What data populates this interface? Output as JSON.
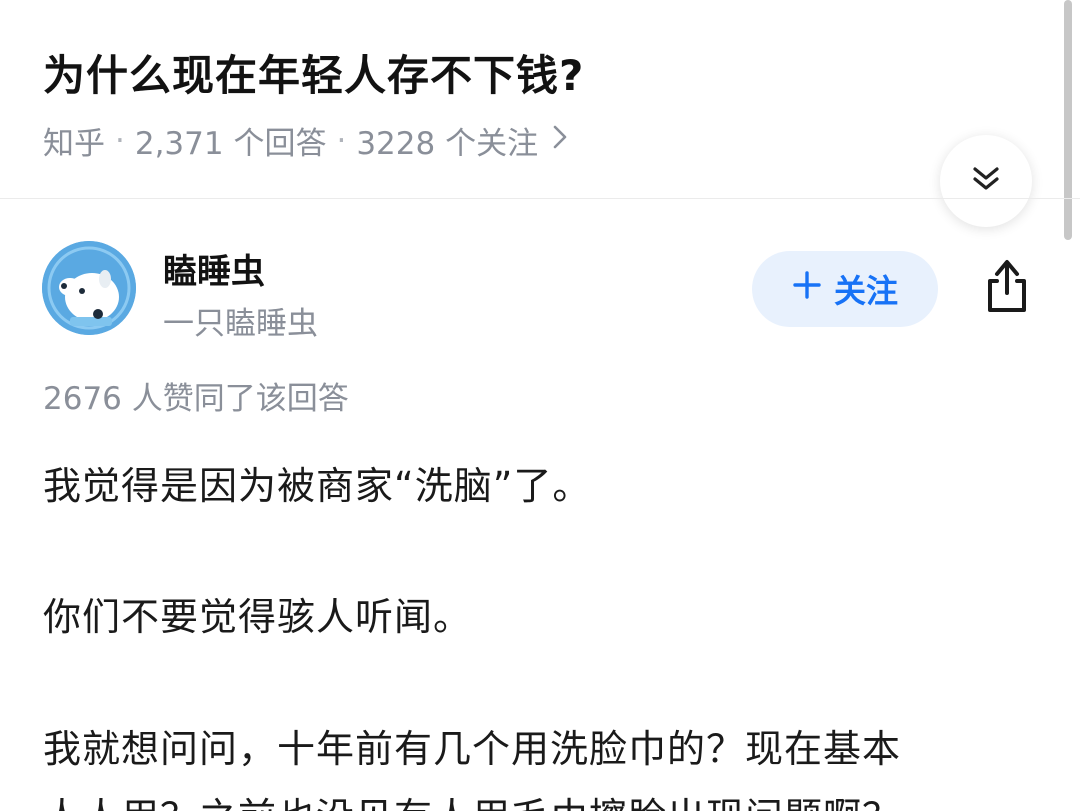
{
  "question": {
    "title": "为什么现在年轻人存不下钱?",
    "source": "知乎",
    "answers_count": "2,371 个回答",
    "followers_count": "3228 个关注",
    "separator": "·"
  },
  "author": {
    "name": "瞌睡虫",
    "bio": "一只瞌睡虫"
  },
  "actions": {
    "follow_label": "关注",
    "follow_icon": "plus-icon",
    "share_icon": "share-icon",
    "collapse_icon": "double-chevron-down-icon"
  },
  "answer": {
    "upvote_text": "2676 人赞同了该回答",
    "paragraphs": [
      "我觉得是因为被商家“洗脑”了。",
      "你们不要觉得骇人听闻。",
      "我就想问问，十年前有几个用洗脸巾的？现在基本",
      "人人用？之前也没见有人用毛巾擦脸出现问题啊？"
    ]
  },
  "colors": {
    "accent": "#1772f6",
    "follow_bg": "#e8f1fd",
    "meta_text": "#8a8f99"
  }
}
